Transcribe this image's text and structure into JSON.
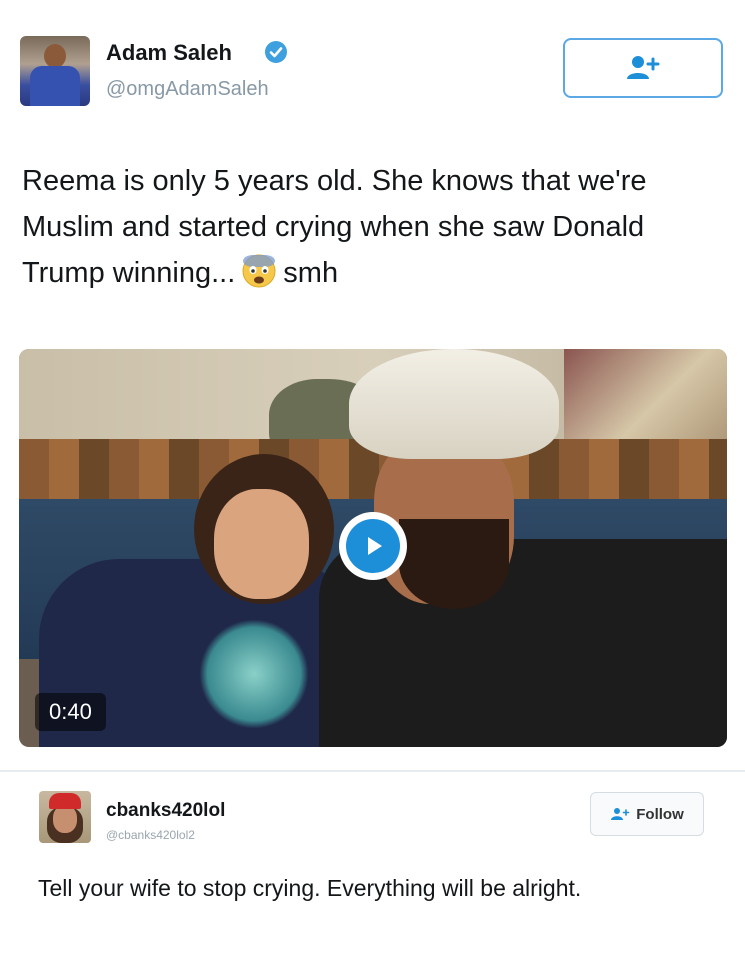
{
  "tweet": {
    "author_name": "Adam Saleh",
    "author_handle": "@omgAdamSaleh",
    "text_before_emoji": "Reema is only 5 years old. She knows that we're Muslim and started crying when she saw Donald Trump winning...",
    "text_after_emoji": "smh",
    "emoji": "fearful-face-emoji",
    "video": {
      "duration": "0:40"
    },
    "follow_icon": "add-user-icon"
  },
  "reply": {
    "author_name": "cbanks420lol",
    "author_handle": "@cbanks420lol2",
    "follow_label": "Follow",
    "text": "Tell your wife to stop crying. Everything will be alright."
  },
  "colors": {
    "accent": "#1d8ed8",
    "border_blue": "#5aa8e6",
    "muted_text": "#8899a6"
  }
}
